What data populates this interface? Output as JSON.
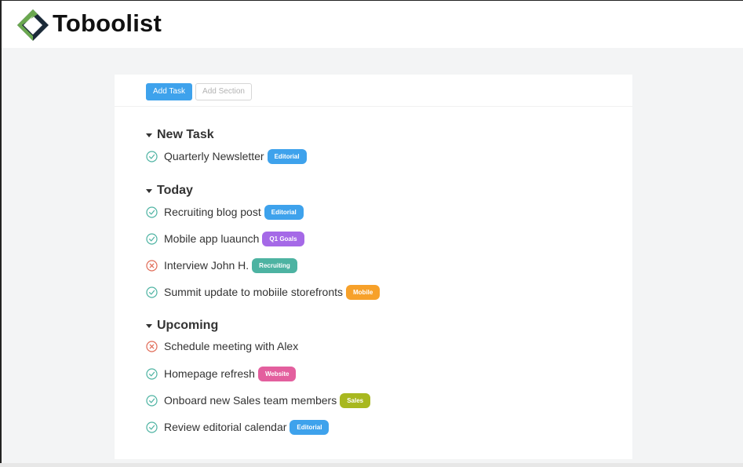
{
  "app": {
    "name": "Toboolist"
  },
  "colors": {
    "brand_green": "#6aa84f",
    "brand_dark": "#1b2a38",
    "accent_blue": "#3ea2ec",
    "check_green": "#4db3a2",
    "cancel_red": "#e06a56"
  },
  "toolbar": {
    "add_task_label": "Add Task",
    "add_section_label": "Add Section"
  },
  "sections": [
    {
      "title": "New Task",
      "tasks": [
        {
          "title": "Quarterly Newsletter",
          "status": "done",
          "tag": "Editorial"
        }
      ]
    },
    {
      "title": "Today",
      "tasks": [
        {
          "title": "Recruiting blog post",
          "status": "done",
          "tag": "Editorial"
        },
        {
          "title": "Mobile app luaunch",
          "status": "done",
          "tag": "Q1 Goals"
        },
        {
          "title": "Interview John H.",
          "status": "cancelled",
          "tag": "Recruiting"
        },
        {
          "title": "Summit update to mobiile storefronts",
          "status": "done",
          "tag": "Mobile"
        }
      ]
    },
    {
      "title": "Upcoming",
      "tasks": [
        {
          "title": "Schedule meeting with Alex",
          "status": "cancelled",
          "tag": ""
        },
        {
          "title": "Homepage refresh",
          "status": "done",
          "tag": "Website"
        },
        {
          "title": "Onboard new Sales team members",
          "status": "done",
          "tag": "Sales"
        },
        {
          "title": "Review editorial calendar",
          "status": "done",
          "tag": "Editorial"
        }
      ]
    }
  ]
}
